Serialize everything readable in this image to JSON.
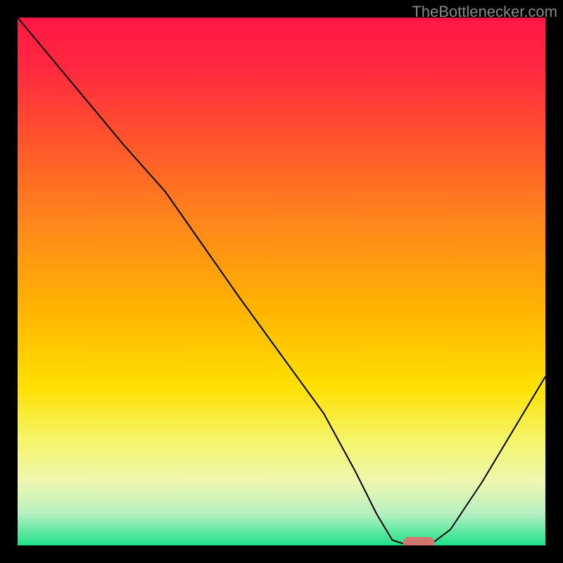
{
  "watermark": "TheBottlenecker.com",
  "chart_data": {
    "type": "line",
    "title": "",
    "xlabel": "",
    "ylabel": "",
    "xlim": [
      0,
      100
    ],
    "ylim": [
      0,
      100
    ],
    "background_gradient": {
      "description": "Vertical gradient from red (top, high bottleneck) through orange/yellow to green (bottom, low bottleneck)",
      "stops": [
        {
          "pos": 0.0,
          "color": "#ff1744"
        },
        {
          "pos": 0.1,
          "color": "#ff2a3f"
        },
        {
          "pos": 0.25,
          "color": "#ff5a2a"
        },
        {
          "pos": 0.4,
          "color": "#ff8a1a"
        },
        {
          "pos": 0.55,
          "color": "#ffb300"
        },
        {
          "pos": 0.7,
          "color": "#ffe000"
        },
        {
          "pos": 0.8,
          "color": "#f5f56a"
        },
        {
          "pos": 0.88,
          "color": "#eef7b0"
        },
        {
          "pos": 0.94,
          "color": "#b6f0c0"
        },
        {
          "pos": 1.0,
          "color": "#1ee28a"
        }
      ]
    },
    "series": [
      {
        "name": "bottleneck-curve",
        "x": [
          0,
          10,
          20,
          28,
          35,
          42,
          50,
          58,
          64,
          68,
          71,
          74,
          78,
          82,
          88,
          94,
          100
        ],
        "y": [
          100,
          88,
          76,
          67,
          57,
          47,
          36,
          25,
          14,
          6,
          1,
          0,
          0,
          3,
          12,
          22,
          32
        ],
        "color": "#000000",
        "width": 2
      }
    ],
    "marker": {
      "description": "Optimal/no-bottleneck zone marker",
      "x_center": 76,
      "y_center": 0.5,
      "width": 6,
      "height": 2.2,
      "color": "#d0766f"
    }
  }
}
